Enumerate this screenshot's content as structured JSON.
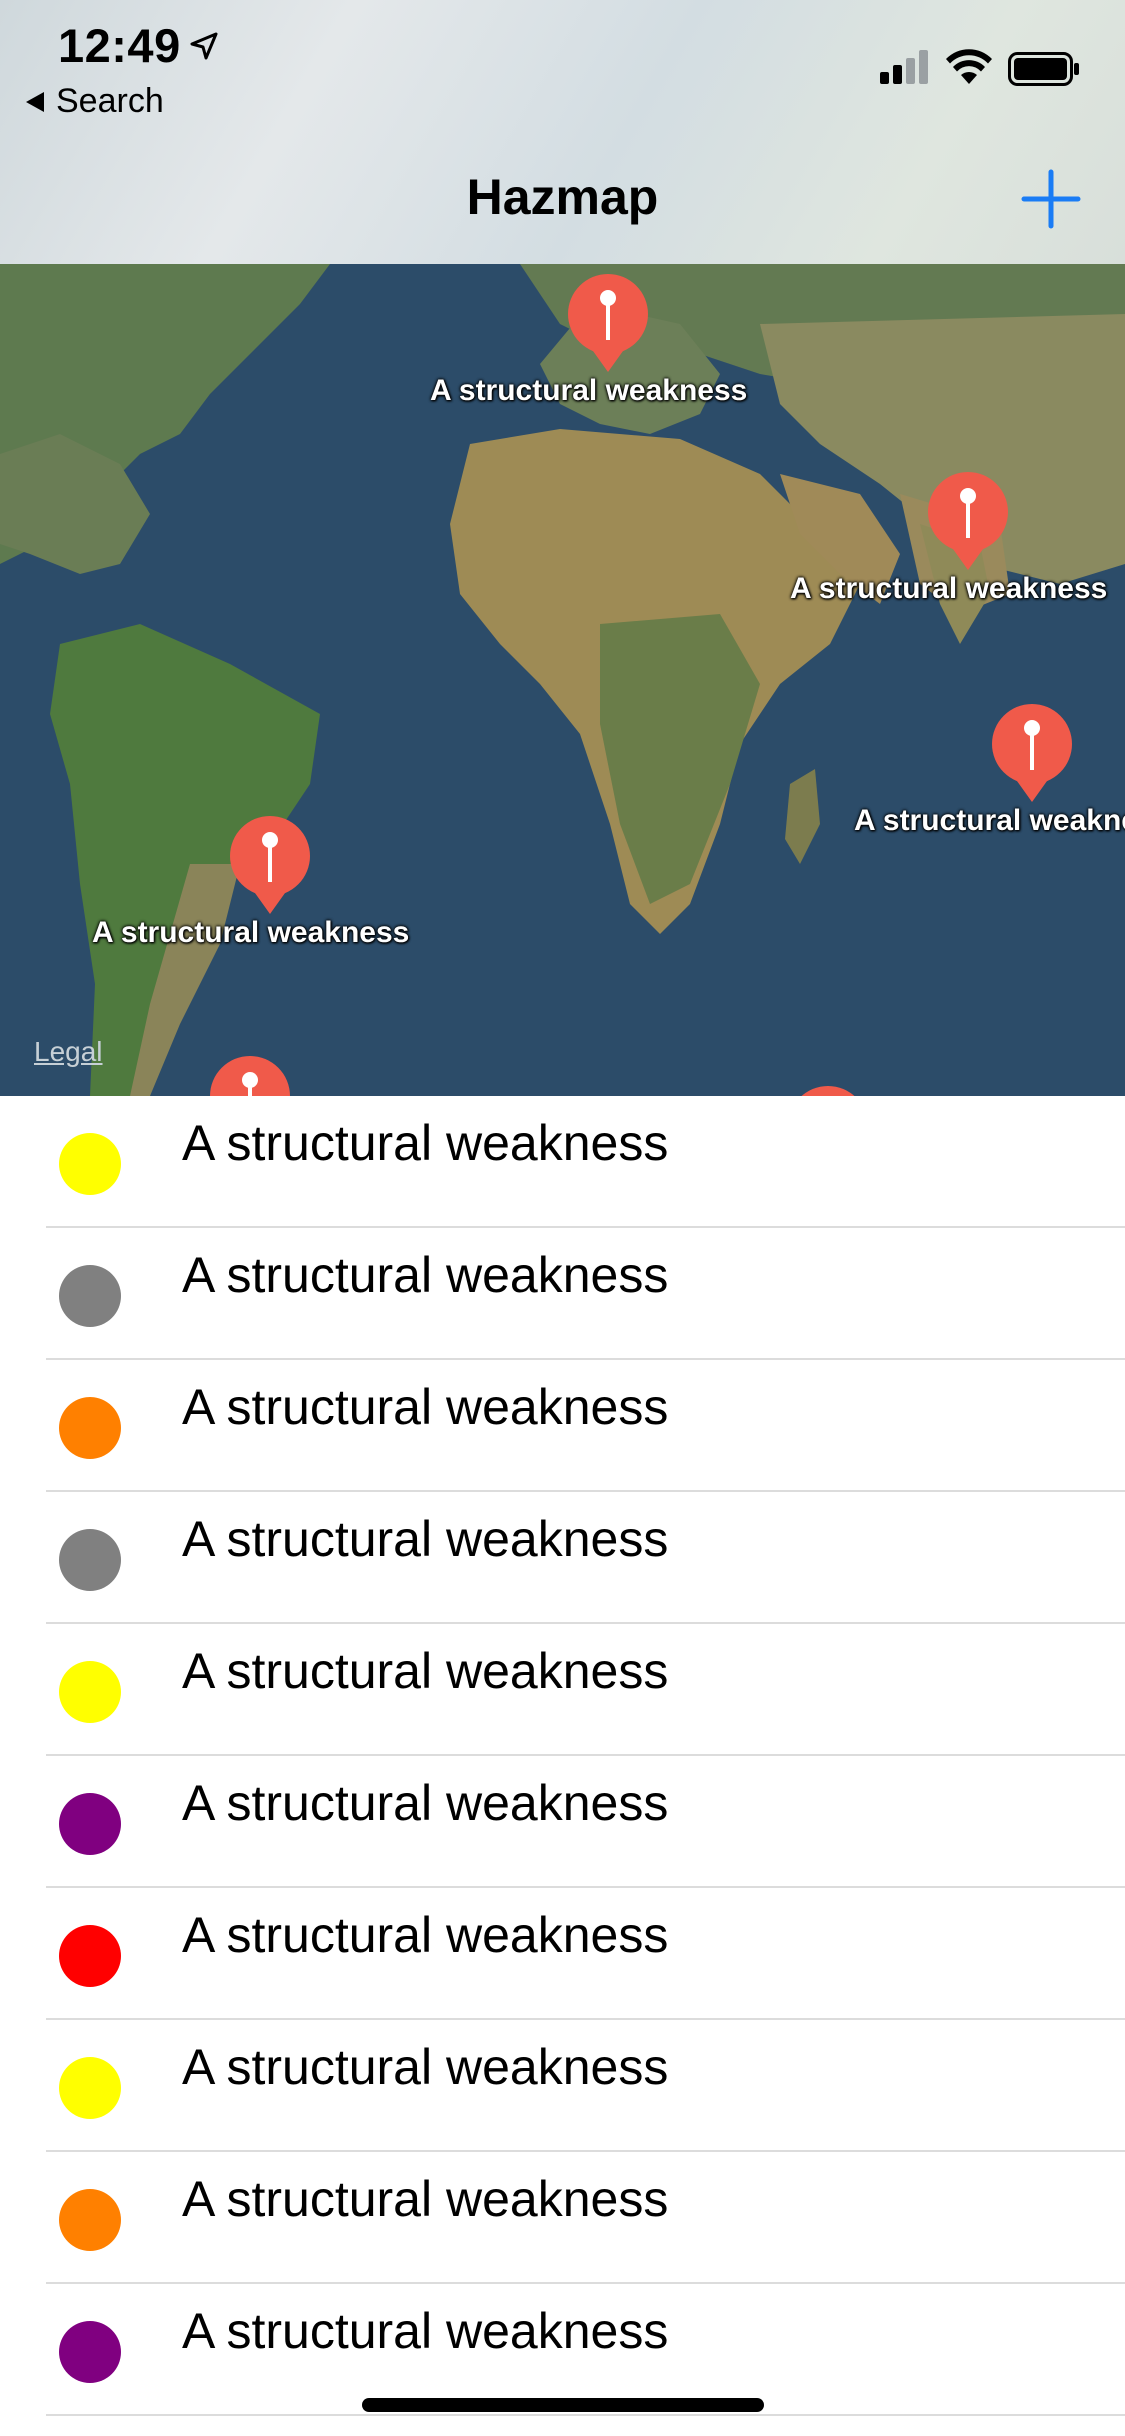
{
  "status": {
    "time": "12:49",
    "back_label": "Search"
  },
  "nav": {
    "title": "Hazmap"
  },
  "map": {
    "legal_label": "Legal",
    "pins": [
      {
        "label": "A structural weakness",
        "color": "#f05a4a"
      },
      {
        "label": "A structural weakness",
        "color": "#f05a4a"
      },
      {
        "label": "A structural weakness",
        "color": "#f05a4a"
      },
      {
        "label": "A structural weakness",
        "color": "#f05a4a"
      },
      {
        "label": "",
        "color": "#f05a4a"
      },
      {
        "label": "",
        "color": "#f05a4a"
      }
    ]
  },
  "hazards": [
    {
      "label": "A structural weakness",
      "color": "#ffff00"
    },
    {
      "label": "A structural weakness",
      "color": "#808080"
    },
    {
      "label": "A structural weakness",
      "color": "#ff8000"
    },
    {
      "label": "A structural weakness",
      "color": "#808080"
    },
    {
      "label": "A structural weakness",
      "color": "#ffff00"
    },
    {
      "label": "A structural weakness",
      "color": "#800080"
    },
    {
      "label": "A structural weakness",
      "color": "#ff0000"
    },
    {
      "label": "A structural weakness",
      "color": "#ffff00"
    },
    {
      "label": "A structural weakness",
      "color": "#ff8000"
    },
    {
      "label": "A structural weakness",
      "color": "#800080"
    }
  ],
  "theme": {
    "accent": "#1a7cf5",
    "pin": "#f05a4a"
  }
}
